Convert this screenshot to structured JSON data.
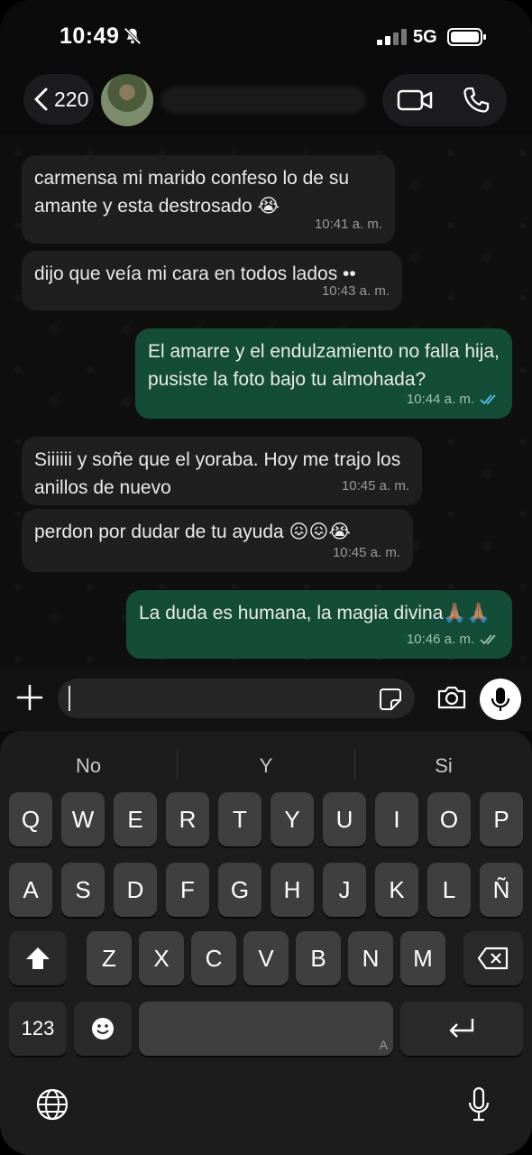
{
  "status": {
    "time": "10:49",
    "network": "5G"
  },
  "header": {
    "back_count": "220"
  },
  "messages": [
    {
      "dir": "in",
      "text": "carmensa mi marido confeso lo de su amante y esta destrosado 😭",
      "time": "10:41 a. m."
    },
    {
      "dir": "in",
      "text": "dijo que veía mi cara en todos lados ••",
      "time": "10:43 a. m."
    },
    {
      "dir": "out",
      "text": "El amarre y el endulzamiento no falla hija, pusiste la foto bajo tu almohada?",
      "time": "10:44 a. m."
    },
    {
      "dir": "in",
      "text": "Siiiiii y soñe que el yoraba. Hoy me trajo los anillos de nuevo",
      "time": "10:45 a. m."
    },
    {
      "dir": "in",
      "text": "perdon por dudar de tu ayuda 😖😖😭",
      "time": "10:45 a. m."
    },
    {
      "dir": "out",
      "text": "La duda es humana, la magia divina🙏🏽🙏🏽",
      "time": "10:46 a. m."
    }
  ],
  "keyboard": {
    "suggestions": [
      "No",
      "Y",
      "Si"
    ],
    "row1": [
      "Q",
      "W",
      "E",
      "R",
      "T",
      "Y",
      "U",
      "I",
      "O",
      "P"
    ],
    "row2": [
      "A",
      "S",
      "D",
      "F",
      "G",
      "H",
      "J",
      "K",
      "L",
      "Ñ"
    ],
    "row3": [
      "Z",
      "X",
      "C",
      "V",
      "B",
      "N",
      "M"
    ],
    "num_key": "123",
    "space_hint": "A"
  },
  "icons": [
    "mute-icon",
    "signal-icon",
    "battery-icon",
    "back-chevron-icon",
    "video-call-icon",
    "phone-icon",
    "plus-icon",
    "sticker-icon",
    "camera-icon",
    "mic-icon",
    "shift-icon",
    "delete-icon",
    "emoji-icon",
    "return-icon",
    "globe-icon",
    "dictation-icon",
    "double-check-icon"
  ],
  "colors": {
    "outgoing_bubble": "#144d37",
    "incoming_bubble": "#1f1f1f",
    "read_ticks": "#53bdeb"
  }
}
